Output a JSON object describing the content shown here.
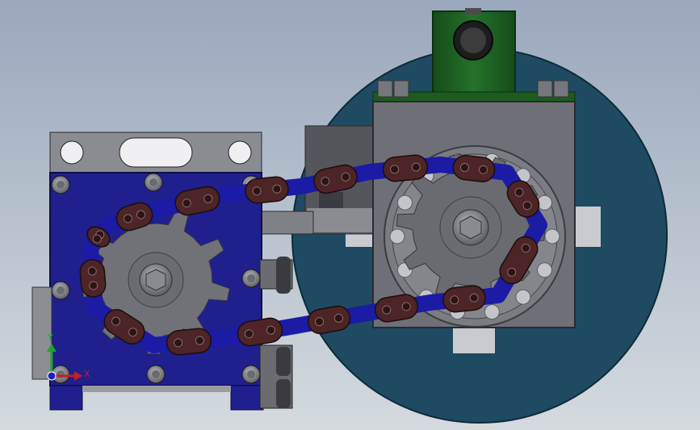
{
  "viewport": {
    "background_top": "#9aa8bd",
    "background_bottom": "#d4dade"
  },
  "colors": {
    "large_disc": "#1e4a62",
    "motor_plate": "#1f1f8e",
    "housing_gray": "#6f7077",
    "light_gray": "#c9c9cd",
    "mount_green": "#1b5b20",
    "chain_link": "#4d2526",
    "chain_inner": "#1b1ba6",
    "axis_y": "#1fa32b",
    "axis_x": "#c42020",
    "axis_z": "#2020c0"
  },
  "triad": {
    "x_label": "X",
    "y_label": "Y",
    "x_icon": "x-axis-arrow-icon",
    "y_icon": "y-axis-arrow-icon",
    "z_icon": "z-axis-dot-icon"
  }
}
